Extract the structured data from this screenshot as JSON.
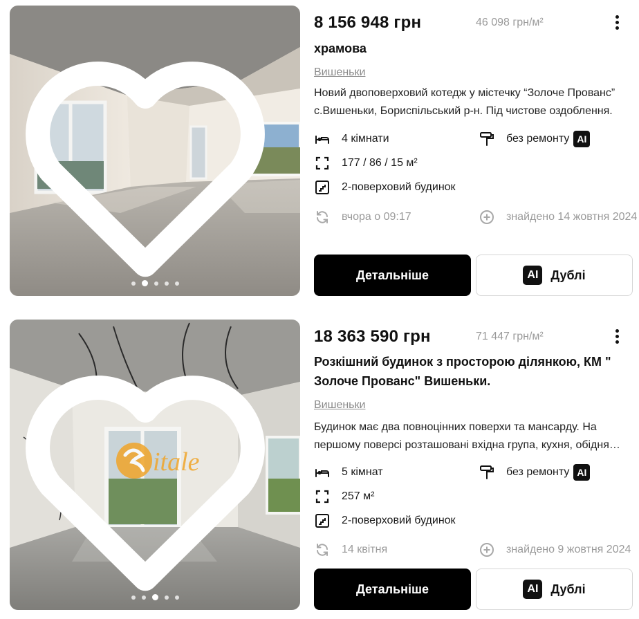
{
  "listings": [
    {
      "price": "8 156 948 грн",
      "price_per_m2": "46 098 грн/м²",
      "title": "храмова",
      "location": "Вишеньки",
      "description": "Новий двоповерховий котедж у містечку “Золоче Прованс” с.Вишеньки, Бориспільський р-н. Під чистове оздоблення.",
      "rooms": "4 кімнати",
      "renovation": "без ремонту",
      "area": "177 / 86 / 15 м²",
      "building": "2-поверховий будинок",
      "updated": "вчора о 09:17",
      "found": "знайдено 14 жовтня 2024",
      "details_label": "Детальніше",
      "duplicates_label": "Дублі",
      "ai_label": "AI",
      "photo_count": 5,
      "photo_active": 1
    },
    {
      "price": "18 363 590 грн",
      "price_per_m2": "71 447 грн/м²",
      "title": "Розкішний будинок з просторою ділянкою, КМ \" Золоче Прованс\" Вишеньки.",
      "location": "Вишеньки",
      "description": "Будинок має два повноцінних поверхи та мансарду. На першому поверсі розташовані вхідна група, кухня, обідня зона.",
      "rooms": "5 кімнат",
      "renovation": "без ремонту",
      "area": "257 м²",
      "building": "2-поверховий будинок",
      "updated": "14 квітня",
      "found": "знайдено 9 жовтня 2024",
      "details_label": "Детальніше",
      "duplicates_label": "Дублі",
      "ai_label": "AI",
      "watermark": "itale",
      "photo_count": 5,
      "photo_active": 2
    }
  ],
  "icons": {
    "favorite": "heart-outline-icon",
    "more": "vertical-dots-icon",
    "rooms": "bed-icon",
    "renovation": "paint-roller-icon",
    "area": "area-corners-icon",
    "building": "stairs-icon",
    "updated": "refresh-icon",
    "found": "plus-circle-icon"
  },
  "colors": {
    "primary_button": "#000000",
    "muted_text": "#9a9a9a",
    "border": "#d6d6d6"
  }
}
